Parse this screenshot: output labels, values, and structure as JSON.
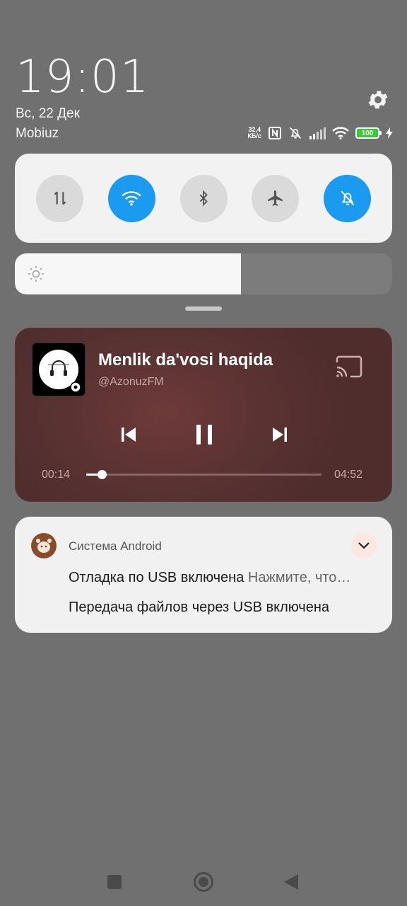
{
  "status": {
    "time": "19:01",
    "date": "Вс, 22 Дек",
    "carrier": "Mobiuz",
    "net_speed_value": "32,4",
    "net_speed_unit": "КБ/с",
    "battery_level": "100"
  },
  "icons": {
    "settings": "gear-icon",
    "nfc": "nfc-icon",
    "mute": "bell-off-icon",
    "signal": "signal-icon",
    "wifi_status": "wifi-icon",
    "charging": "lightning-icon"
  },
  "quick_toggles": [
    {
      "name": "mobile-data",
      "icon": "data-arrows-icon",
      "active": false
    },
    {
      "name": "wifi",
      "icon": "wifi-icon",
      "active": true
    },
    {
      "name": "bluetooth",
      "icon": "bluetooth-icon",
      "active": false
    },
    {
      "name": "airplane-mode",
      "icon": "airplane-icon",
      "active": false
    },
    {
      "name": "silent-mode",
      "icon": "bell-off-icon",
      "active": true
    }
  ],
  "brightness": {
    "level": 0.6,
    "icon": "sun-icon"
  },
  "media": {
    "title": "Menlik da'vosi haqida",
    "artist": "@AzonuzFM",
    "elapsed": "00:14",
    "duration": "04:52",
    "progress": 0.066,
    "state": "playing"
  },
  "notification": {
    "app_name": "Система Android",
    "line1_title": "Отладка по USB включена",
    "line1_detail": "Нажмите, что…",
    "line2": "Передача файлов через USB включена"
  },
  "colors": {
    "accent": "#1a9bf0",
    "media_bg": "#5a3232",
    "battery": "#39c83a"
  }
}
